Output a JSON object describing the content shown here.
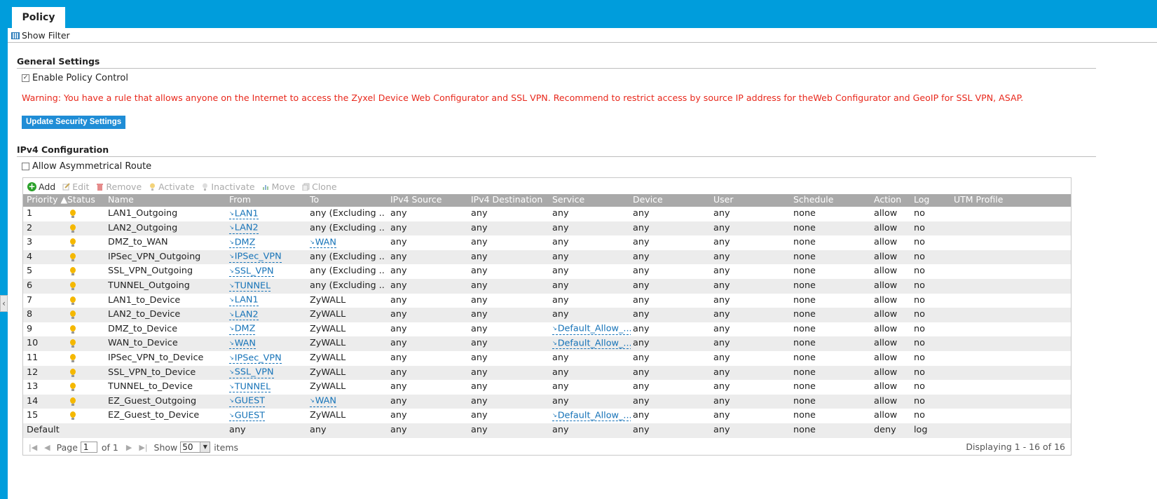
{
  "tab": {
    "label": "Policy"
  },
  "show_filter": "Show Filter",
  "general": {
    "title": "General Settings",
    "enable_label": "Enable Policy Control",
    "warning": "Warning: You have a rule that allows anyone on the Internet to access the Zyxel Device Web Configurator and SSL VPN. Recommend to restrict access by source IP address for theWeb Configurator and GeoIP for SSL VPN, ASAP.",
    "update_button": "Update Security Settings"
  },
  "ipv4": {
    "title": "IPv4 Configuration",
    "asym_label": "Allow Asymmetrical Route"
  },
  "toolbar": {
    "add": "Add",
    "edit": "Edit",
    "remove": "Remove",
    "activate": "Activate",
    "inactivate": "Inactivate",
    "move": "Move",
    "clone": "Clone"
  },
  "columns": {
    "priority": "Priority ▲",
    "status": "Status",
    "name": "Name",
    "from": "From",
    "to": "To",
    "src": "IPv4 Source",
    "dst": "IPv4 Destination",
    "service": "Service",
    "device": "Device",
    "user": "User",
    "schedule": "Schedule",
    "action": "Action",
    "log": "Log",
    "utm": "UTM Profile"
  },
  "rows": [
    {
      "p": "1",
      "name": "LAN1_Outgoing",
      "from": "LAN1",
      "to": "any (Excluding ...",
      "src": "any",
      "dst": "any",
      "service": "any",
      "device": "any",
      "user": "any",
      "schedule": "none",
      "action": "allow",
      "log": "no"
    },
    {
      "p": "2",
      "name": "LAN2_Outgoing",
      "from": "LAN2",
      "to": "any (Excluding ...",
      "src": "any",
      "dst": "any",
      "service": "any",
      "device": "any",
      "user": "any",
      "schedule": "none",
      "action": "allow",
      "log": "no"
    },
    {
      "p": "3",
      "name": "DMZ_to_WAN",
      "from": "DMZ",
      "to": "WAN",
      "src": "any",
      "dst": "any",
      "service": "any",
      "device": "any",
      "user": "any",
      "schedule": "none",
      "action": "allow",
      "log": "no"
    },
    {
      "p": "4",
      "name": "IPSec_VPN_Outgoing",
      "from": "IPSec_VPN",
      "to": "any (Excluding ...",
      "src": "any",
      "dst": "any",
      "service": "any",
      "device": "any",
      "user": "any",
      "schedule": "none",
      "action": "allow",
      "log": "no"
    },
    {
      "p": "5",
      "name": "SSL_VPN_Outgoing",
      "from": "SSL_VPN",
      "to": "any (Excluding ...",
      "src": "any",
      "dst": "any",
      "service": "any",
      "device": "any",
      "user": "any",
      "schedule": "none",
      "action": "allow",
      "log": "no"
    },
    {
      "p": "6",
      "name": "TUNNEL_Outgoing",
      "from": "TUNNEL",
      "to": "any (Excluding ...",
      "src": "any",
      "dst": "any",
      "service": "any",
      "device": "any",
      "user": "any",
      "schedule": "none",
      "action": "allow",
      "log": "no"
    },
    {
      "p": "7",
      "name": "LAN1_to_Device",
      "from": "LAN1",
      "to": "ZyWALL",
      "src": "any",
      "dst": "any",
      "service": "any",
      "device": "any",
      "user": "any",
      "schedule": "none",
      "action": "allow",
      "log": "no"
    },
    {
      "p": "8",
      "name": "LAN2_to_Device",
      "from": "LAN2",
      "to": "ZyWALL",
      "src": "any",
      "dst": "any",
      "service": "any",
      "device": "any",
      "user": "any",
      "schedule": "none",
      "action": "allow",
      "log": "no"
    },
    {
      "p": "9",
      "name": "DMZ_to_Device",
      "from": "DMZ",
      "to": "ZyWALL",
      "src": "any",
      "dst": "any",
      "service": "Default_Allow_...",
      "device": "any",
      "user": "any",
      "schedule": "none",
      "action": "allow",
      "log": "no"
    },
    {
      "p": "10",
      "name": "WAN_to_Device",
      "from": "WAN",
      "to": "ZyWALL",
      "src": "any",
      "dst": "any",
      "service": "Default_Allow_...",
      "device": "any",
      "user": "any",
      "schedule": "none",
      "action": "allow",
      "log": "no"
    },
    {
      "p": "11",
      "name": "IPSec_VPN_to_Device",
      "from": "IPSec_VPN",
      "to": "ZyWALL",
      "src": "any",
      "dst": "any",
      "service": "any",
      "device": "any",
      "user": "any",
      "schedule": "none",
      "action": "allow",
      "log": "no"
    },
    {
      "p": "12",
      "name": "SSL_VPN_to_Device",
      "from": "SSL_VPN",
      "to": "ZyWALL",
      "src": "any",
      "dst": "any",
      "service": "any",
      "device": "any",
      "user": "any",
      "schedule": "none",
      "action": "allow",
      "log": "no"
    },
    {
      "p": "13",
      "name": "TUNNEL_to_Device",
      "from": "TUNNEL",
      "to": "ZyWALL",
      "src": "any",
      "dst": "any",
      "service": "any",
      "device": "any",
      "user": "any",
      "schedule": "none",
      "action": "allow",
      "log": "no"
    },
    {
      "p": "14",
      "name": "EZ_Guest_Outgoing",
      "from": "GUEST",
      "to": "WAN",
      "src": "any",
      "dst": "any",
      "service": "any",
      "device": "any",
      "user": "any",
      "schedule": "none",
      "action": "allow",
      "log": "no"
    },
    {
      "p": "15",
      "name": "EZ_Guest_to_Device",
      "from": "GUEST",
      "to": "ZyWALL",
      "src": "any",
      "dst": "any",
      "service": "Default_Allow_...",
      "device": "any",
      "user": "any",
      "schedule": "none",
      "action": "allow",
      "log": "no"
    },
    {
      "p": "Default",
      "name": "",
      "from": "any",
      "to": "any",
      "src": "any",
      "dst": "any",
      "service": "any",
      "device": "any",
      "user": "any",
      "schedule": "none",
      "action": "deny",
      "log": "log"
    }
  ],
  "pager": {
    "page_label": "Page",
    "page_value": "1",
    "of_label": "of 1",
    "show_label": "Show",
    "show_value": "50",
    "items_label": "items",
    "displaying": "Displaying 1 - 16 of 16"
  }
}
